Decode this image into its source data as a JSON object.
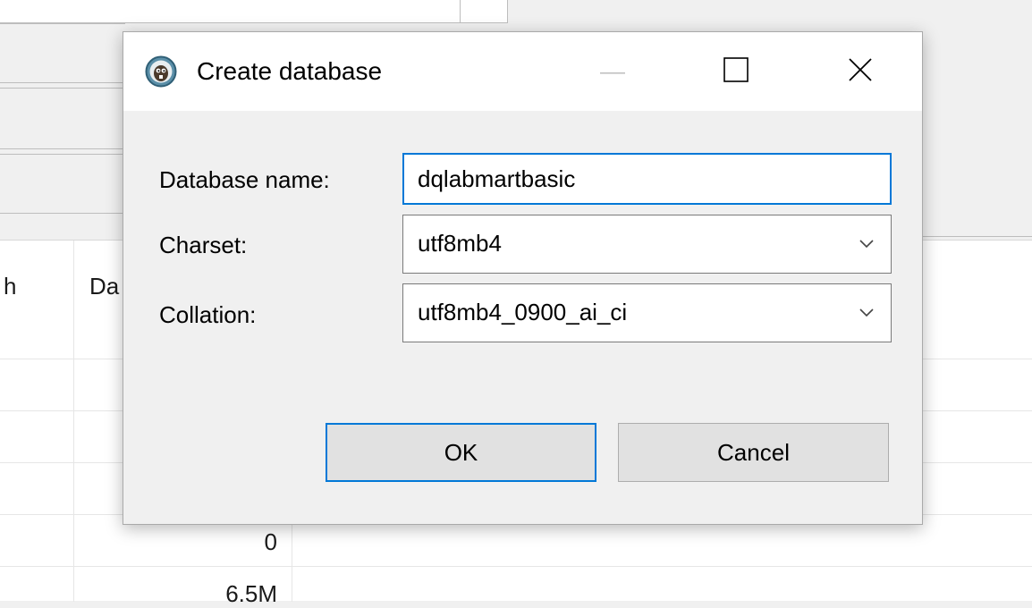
{
  "dialog": {
    "title": "Create database",
    "fields": {
      "database_name": {
        "label": "Database name:",
        "value": "dqlabmartbasic"
      },
      "charset": {
        "label": "Charset:",
        "value": "utf8mb4"
      },
      "collation": {
        "label": "Collation:",
        "value": "utf8mb4_0900_ai_ci"
      }
    },
    "buttons": {
      "ok": "OK",
      "cancel": "Cancel"
    },
    "window_controls": [
      "minimize-icon",
      "maximize-icon",
      "close-icon"
    ],
    "app_icon": "dbeaver-beaver-icon",
    "accent_color": "#0078d7"
  },
  "background": {
    "grid": {
      "headers": [
        "h",
        "Da"
      ],
      "values": [
        "0",
        "6.5M"
      ]
    }
  }
}
